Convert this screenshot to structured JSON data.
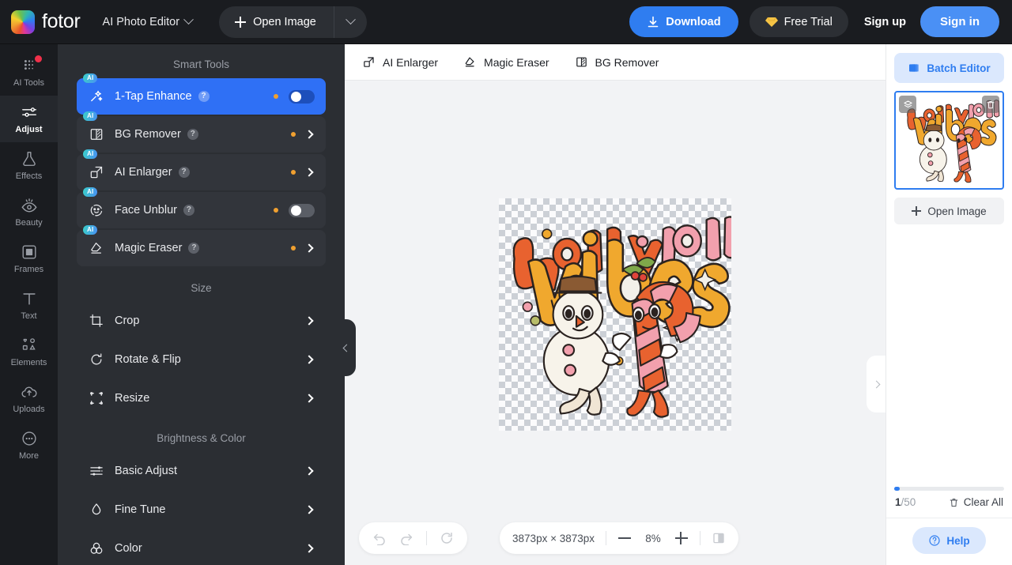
{
  "header": {
    "logo_text": "fotor",
    "app_mode": "AI Photo Editor",
    "open_image": "Open Image",
    "download": "Download",
    "free_trial": "Free Trial",
    "sign_up": "Sign up",
    "sign_in": "Sign in",
    "accent_blue": "#2f7df0",
    "signin_blue": "#4a90f5"
  },
  "rail": {
    "items": [
      {
        "label": "AI Tools",
        "icon": "ai-tools-icon",
        "active": false,
        "badge": true
      },
      {
        "label": "Adjust",
        "icon": "adjust-icon",
        "active": true,
        "badge": false
      },
      {
        "label": "Effects",
        "icon": "effects-icon",
        "active": false,
        "badge": false
      },
      {
        "label": "Beauty",
        "icon": "beauty-icon",
        "active": false,
        "badge": false
      },
      {
        "label": "Frames",
        "icon": "frames-icon",
        "active": false,
        "badge": false
      },
      {
        "label": "Text",
        "icon": "text-icon",
        "active": false,
        "badge": false
      },
      {
        "label": "Elements",
        "icon": "elements-icon",
        "active": false,
        "badge": false
      },
      {
        "label": "Uploads",
        "icon": "uploads-icon",
        "active": false,
        "badge": false
      },
      {
        "label": "More",
        "icon": "more-icon",
        "active": false,
        "badge": false
      }
    ]
  },
  "tools_panel": {
    "sections": [
      {
        "title": "Smart Tools"
      },
      {
        "title": "Size"
      },
      {
        "title": "Brightness & Color"
      }
    ],
    "smart_tools": [
      {
        "label": "1-Tap Enhance",
        "ai": "AI",
        "help": "?",
        "dot": true,
        "control": "toggle",
        "toggle_on": true,
        "active": true
      },
      {
        "label": "BG Remover",
        "ai": "AI",
        "help": "?",
        "dot": true,
        "control": "chevron",
        "active": false
      },
      {
        "label": "AI Enlarger",
        "ai": "AI",
        "help": "?",
        "dot": true,
        "control": "chevron",
        "active": false
      },
      {
        "label": "Face Unblur",
        "ai": "AI",
        "help": "?",
        "dot": true,
        "control": "toggle",
        "toggle_on": false,
        "active": false
      },
      {
        "label": "Magic Eraser",
        "ai": "AI",
        "help": "?",
        "dot": true,
        "control": "chevron",
        "active": false
      }
    ],
    "size_tools": [
      {
        "label": "Crop",
        "icon": "crop-icon"
      },
      {
        "label": "Rotate & Flip",
        "icon": "rotate-icon"
      },
      {
        "label": "Resize",
        "icon": "resize-icon"
      }
    ],
    "color_tools": [
      {
        "label": "Basic Adjust",
        "icon": "sliders-icon"
      },
      {
        "label": "Fine Tune",
        "icon": "droplet-icon"
      },
      {
        "label": "Color",
        "icon": "color-circles-icon"
      }
    ]
  },
  "canvas": {
    "topbar": [
      {
        "label": "AI Enlarger",
        "icon": "ai-enlarger-icon"
      },
      {
        "label": "Magic Eraser",
        "icon": "magic-eraser-icon"
      },
      {
        "label": "BG Remover",
        "icon": "bg-remover-icon"
      }
    ],
    "artwork_text": "holly jolly vibes",
    "dimensions": "3873px × 3873px",
    "zoom_level": "8%",
    "minus": "",
    "plus": ""
  },
  "right_panel": {
    "batch_editor": "Batch Editor",
    "open_image": "Open Image",
    "count_current": "1",
    "count_total": "/50",
    "clear_all": "Clear All",
    "help": "Help",
    "accent": "#2f7df0"
  }
}
